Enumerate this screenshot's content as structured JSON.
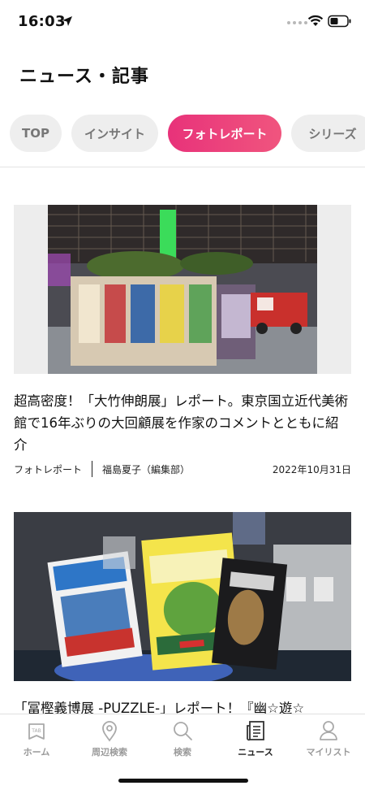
{
  "status_bar": {
    "time": "16:03",
    "icons": [
      "location-arrow-icon",
      "signal-icon",
      "wifi-icon",
      "battery-icon"
    ]
  },
  "header": {
    "title": "ニュース・記事"
  },
  "tabs": [
    {
      "label": "TOP",
      "active": false
    },
    {
      "label": "インサイト",
      "active": false
    },
    {
      "label": "フォトレポート",
      "active": true
    },
    {
      "label": "シリーズ",
      "active": false
    }
  ],
  "articles": [
    {
      "title": "超高密度！「大竹伸朗展」レポート。東京国立近代美術館で16年ぶりの大回顧展を作家のコメントとともに紹介",
      "category": "フォトレポート",
      "author": "福島夏子（編集部）",
      "date": "2022年10月31日"
    },
    {
      "title": "「冨樫義博展 -PUZZLE-」レポート！『幽☆遊☆"
    }
  ],
  "tab_bar": [
    {
      "label": "ホーム",
      "icon": "tab-logo-icon",
      "active": false
    },
    {
      "label": "周辺検索",
      "icon": "map-pin-icon",
      "active": false
    },
    {
      "label": "検索",
      "icon": "search-icon",
      "active": false
    },
    {
      "label": "ニュース",
      "icon": "news-icon",
      "active": true
    },
    {
      "label": "マイリスト",
      "icon": "person-icon",
      "active": false
    }
  ],
  "colors": {
    "accent": "#e8327a",
    "inactive_tab": "#eeeeee",
    "inactive_text": "#9a9a9a"
  }
}
